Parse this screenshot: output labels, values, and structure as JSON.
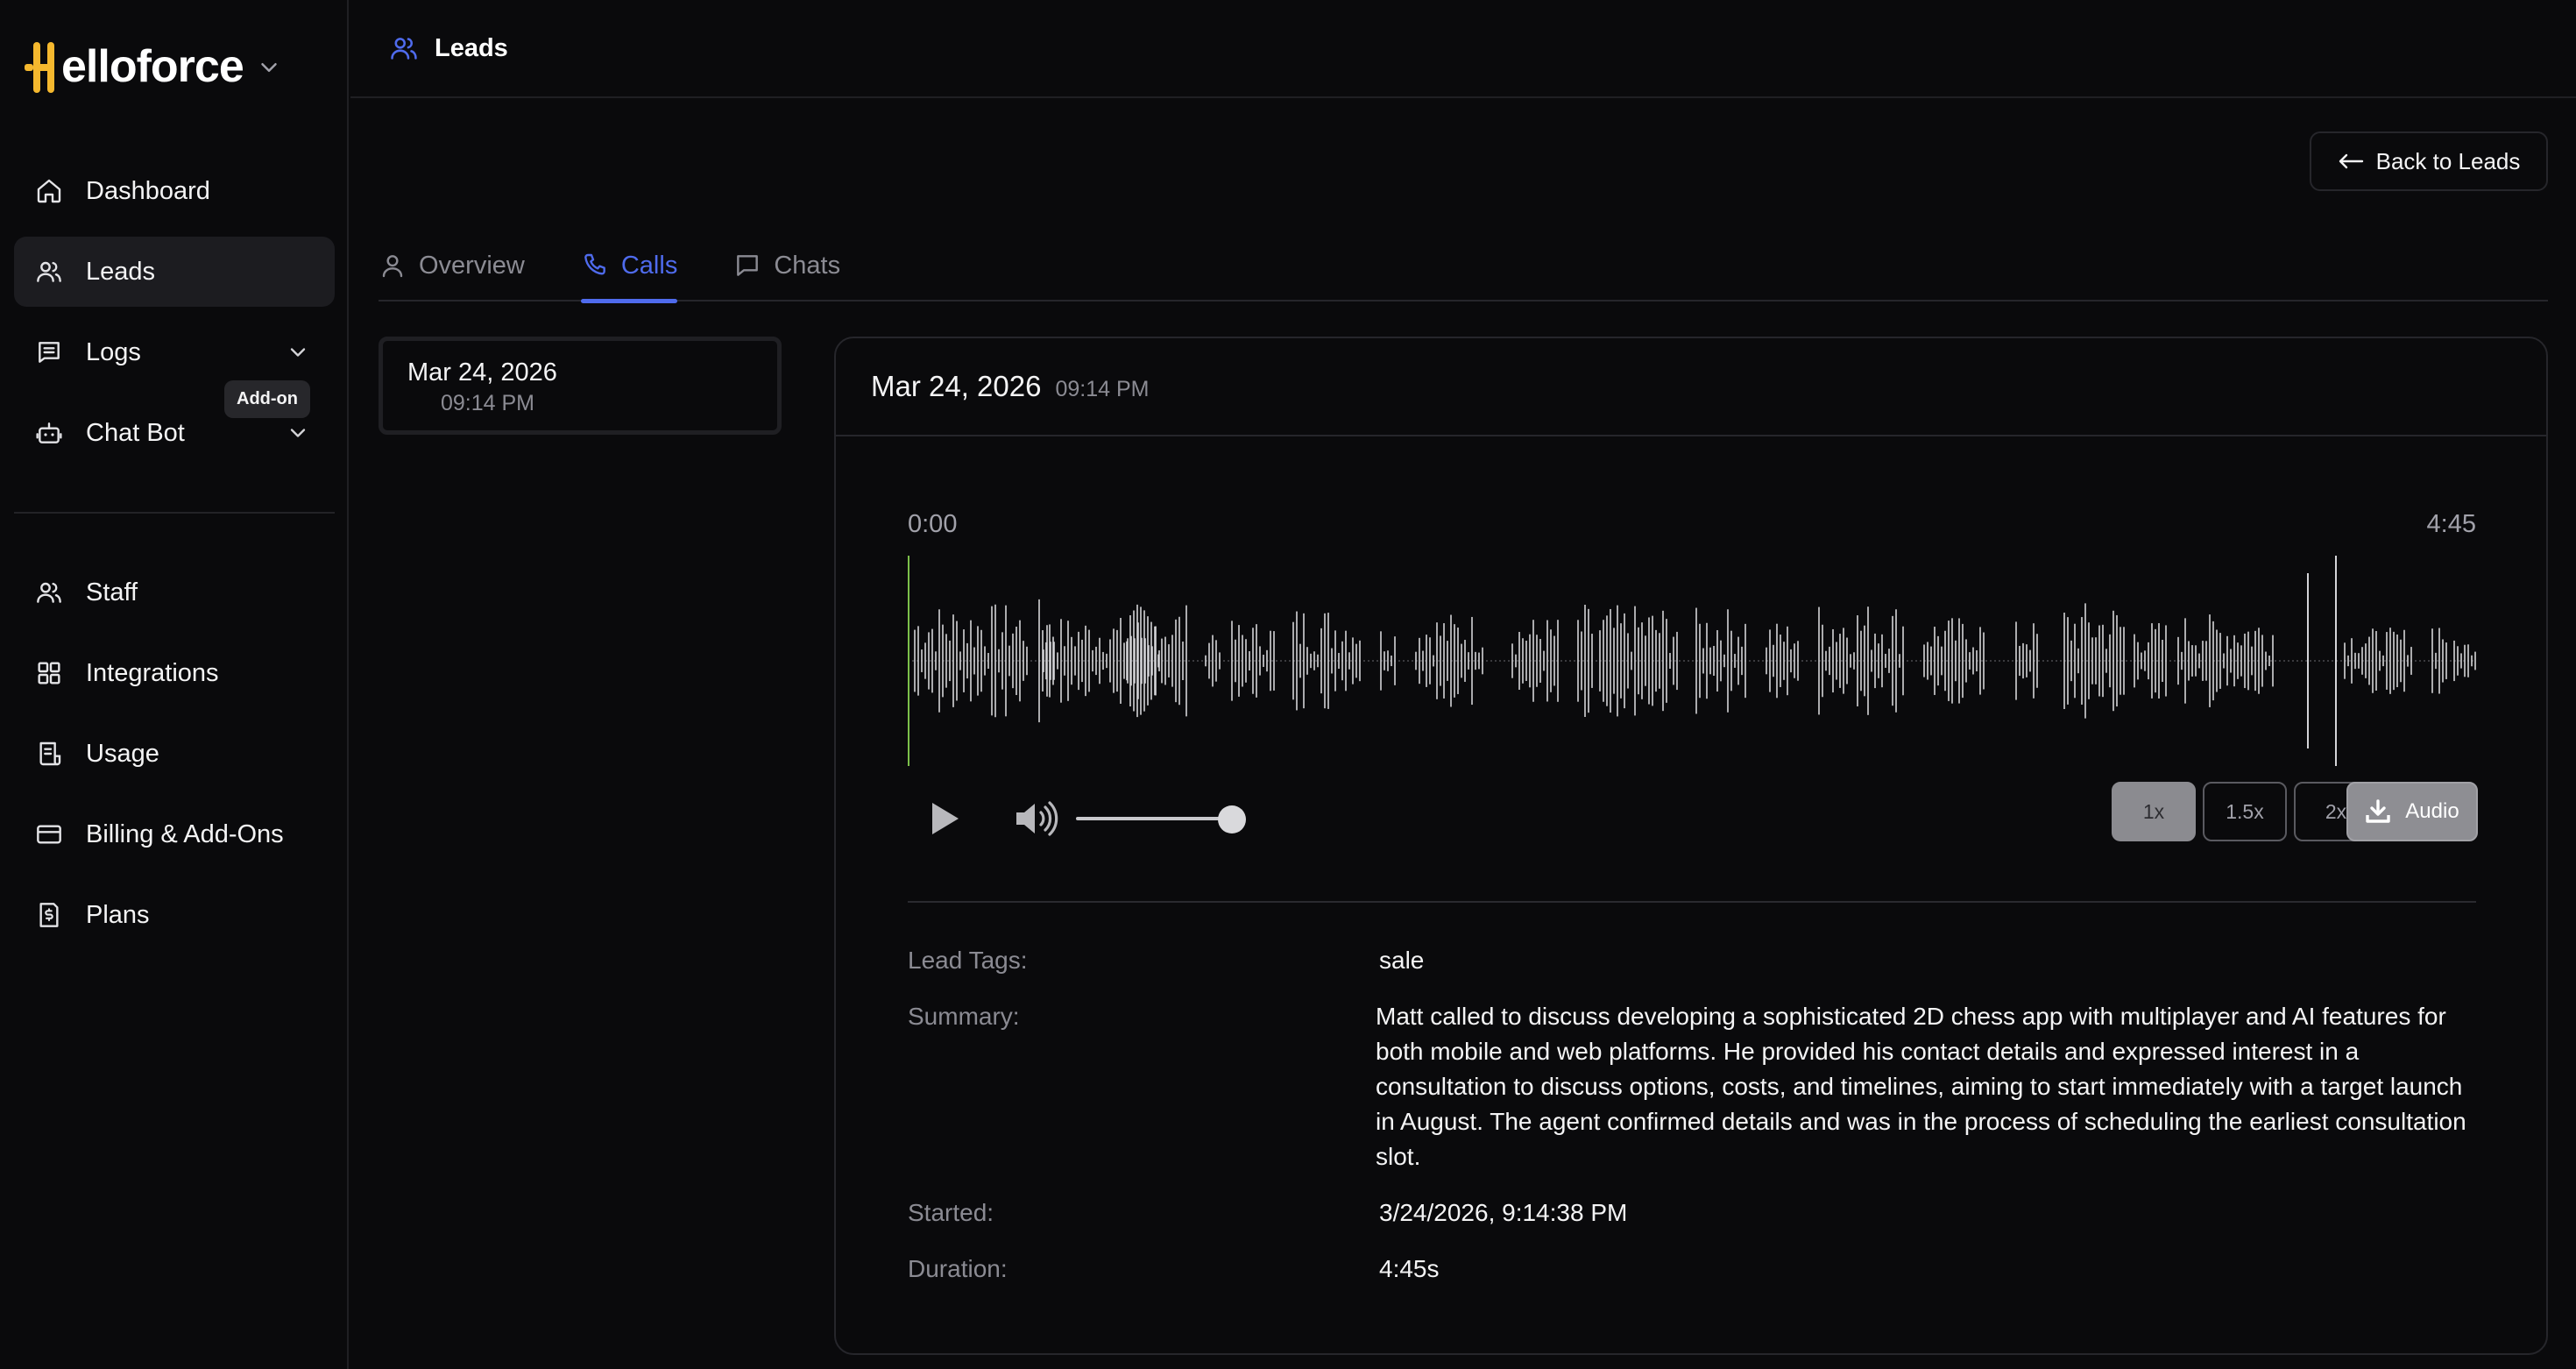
{
  "brand": {
    "name": "elloforce",
    "accent": "#f5b82e"
  },
  "sidebar": {
    "nav_primary": [
      {
        "label": "Dashboard",
        "icon": "home-icon"
      },
      {
        "label": "Leads",
        "icon": "users-icon",
        "active": true
      },
      {
        "label": "Logs",
        "icon": "logs-icon",
        "expandable": true
      },
      {
        "label": "Chat Bot",
        "icon": "bot-icon",
        "expandable": true
      }
    ],
    "addon_tooltip": "Add-on",
    "nav_secondary": [
      {
        "label": "Staff",
        "icon": "users-icon"
      },
      {
        "label": "Integrations",
        "icon": "grid-icon"
      },
      {
        "label": "Usage",
        "icon": "receipt-icon"
      },
      {
        "label": "Billing & Add-Ons",
        "icon": "credit-card-icon"
      },
      {
        "label": "Plans",
        "icon": "dollar-file-icon"
      }
    ]
  },
  "header": {
    "title": "Leads"
  },
  "back_button": {
    "label": "Back to Leads"
  },
  "tabs": [
    {
      "label": "Overview",
      "active": false
    },
    {
      "label": "Calls",
      "active": true
    },
    {
      "label": "Chats",
      "active": false
    }
  ],
  "call_list": [
    {
      "date": "Mar 24, 2026",
      "time": "09:14 PM"
    }
  ],
  "call_detail": {
    "date": "Mar 24, 2026",
    "time": "09:14 PM",
    "player": {
      "current_time": "0:00",
      "total_time": "4:45",
      "volume": 1.0,
      "rates": [
        "1x",
        "1.5x",
        "2x"
      ],
      "active_rate": "1x",
      "audio_label": "Audio"
    },
    "fields": {
      "lead_tags_label": "Lead Tags:",
      "lead_tags": "sale",
      "summary_label": "Summary:",
      "summary": "Matt called to discuss developing a sophisticated 2D chess app with multiplayer and AI features for both mobile and web platforms. He provided his contact details and expressed interest in a consultation to discuss options, costs, and timelines, aiming to start immediately with a target launch in August. The agent confirmed details and was in the process of scheduling the earliest consultation slot.",
      "started_label": "Started:",
      "started": "3/24/2026, 9:14:38 PM",
      "duration_label": "Duration:",
      "duration": "4:45s"
    }
  },
  "colors": {
    "accent_blue": "#4f6bed",
    "background": "#0a0a0c",
    "playhead": "#7cc04a"
  }
}
